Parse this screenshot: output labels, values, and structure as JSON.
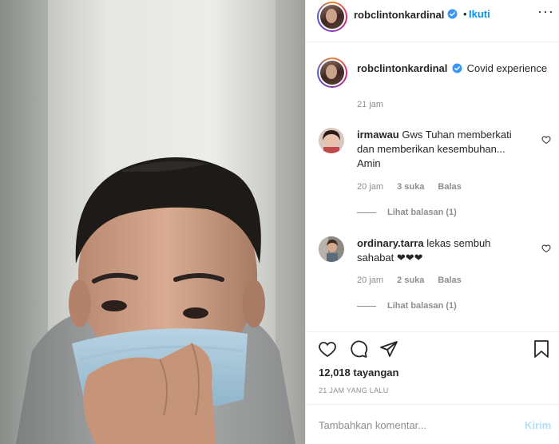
{
  "post": {
    "username": "robclintonkardinal",
    "follow_label": "Ikuti",
    "separator": "•",
    "more_label": "···"
  },
  "caption": {
    "username": "robclintonkardinal",
    "text": "Covid experience",
    "time": "21 jam"
  },
  "comments": [
    {
      "username": "irmawau",
      "text": "Gws Tuhan memberkati dan memberikan kesembuhan... Amin",
      "time": "20 jam",
      "likes": "3 suka",
      "reply_label": "Balas",
      "view_replies": "Lihat balasan (1)"
    },
    {
      "username": "ordinary.tarra",
      "text": "lekas sembuh sahabat ❤❤❤",
      "time": "20 jam",
      "likes": "2 suka",
      "reply_label": "Balas",
      "view_replies": "Lihat balasan (1)"
    }
  ],
  "stats": {
    "views": "12,018 tayangan",
    "posted": "21 JAM YANG LALU"
  },
  "add_comment": {
    "placeholder": "Tambahkan komentar...",
    "post_label": "Kirim"
  },
  "icons": {
    "verified": "verified-badge-icon",
    "like": "heart-icon",
    "comment": "comment-bubble-icon",
    "share": "paper-plane-icon",
    "save": "bookmark-icon",
    "comment_like": "small-heart-icon"
  },
  "colors": {
    "accent": "#0095f6",
    "muted": "#8e8e8e",
    "text": "#262626",
    "post_disabled": "#b2dffc"
  }
}
